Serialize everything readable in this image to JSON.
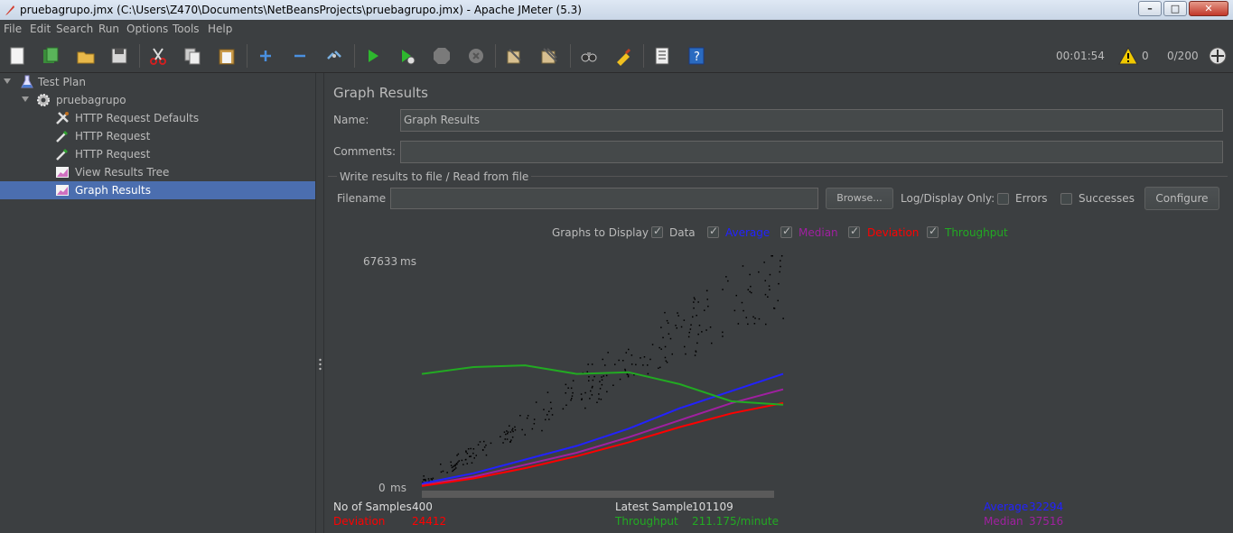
{
  "window": {
    "title": "pruebagrupo.jmx (C:\\Users\\Z470\\Documents\\NetBeansProjects\\pruebagrupo.jmx) - Apache JMeter (5.3)"
  },
  "menu": [
    "File",
    "Edit",
    "Search",
    "Run",
    "Options",
    "Tools",
    "Help"
  ],
  "toolbar": {
    "icons": [
      "new-icon",
      "templates-icon",
      "open-icon",
      "save-icon",
      "cut-icon",
      "copy-icon",
      "paste-icon",
      "expand-icon",
      "collapse-icon",
      "toggle-icon",
      "start-icon",
      "start-no-pauses-icon",
      "stop-icon",
      "shutdown-icon",
      "clear-icon",
      "clear-all-icon",
      "search-icon",
      "reset-search-icon",
      "function-helper-icon",
      "help-icon"
    ],
    "elapsed": "00:01:54",
    "warnings": "0",
    "threads": "0/200"
  },
  "tree": {
    "items": [
      {
        "label": "Test Plan",
        "icon": "flask-icon"
      },
      {
        "label": "pruebagrupo",
        "icon": "gear-icon"
      },
      {
        "label": "HTTP Request Defaults",
        "icon": "tools-icon"
      },
      {
        "label": "HTTP Request",
        "icon": "pipette-icon"
      },
      {
        "label": "HTTP Request",
        "icon": "pipette-icon"
      },
      {
        "label": "View Results Tree",
        "icon": "chart-icon"
      },
      {
        "label": "Graph Results",
        "icon": "chart-icon"
      }
    ]
  },
  "panel": {
    "title": "Graph Results",
    "name_label": "Name:",
    "name_value": "Graph Results",
    "comments_label": "Comments:",
    "comments_value": "",
    "file_section": "Write results to file / Read from file",
    "filename_label": "Filename",
    "filename_value": "",
    "browse": "Browse...",
    "log_display": "Log/Display Only:",
    "errors": "Errors",
    "successes": "Successes",
    "configure": "Configure"
  },
  "graphs_to_display": {
    "label": "Graphs to Display",
    "options": [
      {
        "label": "Data",
        "color": "#bbbbbb",
        "checked": true
      },
      {
        "label": "Average",
        "color": "#2222ff",
        "checked": true
      },
      {
        "label": "Median",
        "color": "#a020a0",
        "checked": true
      },
      {
        "label": "Deviation",
        "color": "#ff0000",
        "checked": true
      },
      {
        "label": "Throughput",
        "color": "#22aa22",
        "checked": true
      }
    ]
  },
  "chart_data": {
    "type": "line",
    "y_max_label": "67633",
    "y_min_label": "0",
    "y_unit": "ms",
    "ylim": [
      0,
      67633
    ],
    "series": [
      {
        "name": "Average",
        "color": "#2222ff",
        "values": [
          1000,
          4000,
          8000,
          12000,
          17000,
          23000,
          28000,
          33000
        ]
      },
      {
        "name": "Median",
        "color": "#a020a0",
        "values": [
          500,
          3000,
          6500,
          10000,
          14500,
          19500,
          24500,
          28500
        ]
      },
      {
        "name": "Deviation",
        "color": "#ff0000",
        "values": [
          300,
          2500,
          5500,
          9000,
          13000,
          17500,
          21500,
          24500
        ]
      },
      {
        "name": "Throughput",
        "color": "#22aa22",
        "values": [
          33000,
          35000,
          35500,
          33000,
          33500,
          30000,
          25000,
          24000
        ]
      }
    ]
  },
  "stats": {
    "samples_label": "No of Samples",
    "samples_value": "400",
    "latest_label": "Latest Sample",
    "latest_value": "101109",
    "average_label": "Average",
    "average_value": "32294",
    "deviation_label": "Deviation",
    "deviation_value": "24412",
    "throughput_label": "Throughput",
    "throughput_value": "211.175/minute",
    "median_label": "Median",
    "median_value": "37516"
  }
}
